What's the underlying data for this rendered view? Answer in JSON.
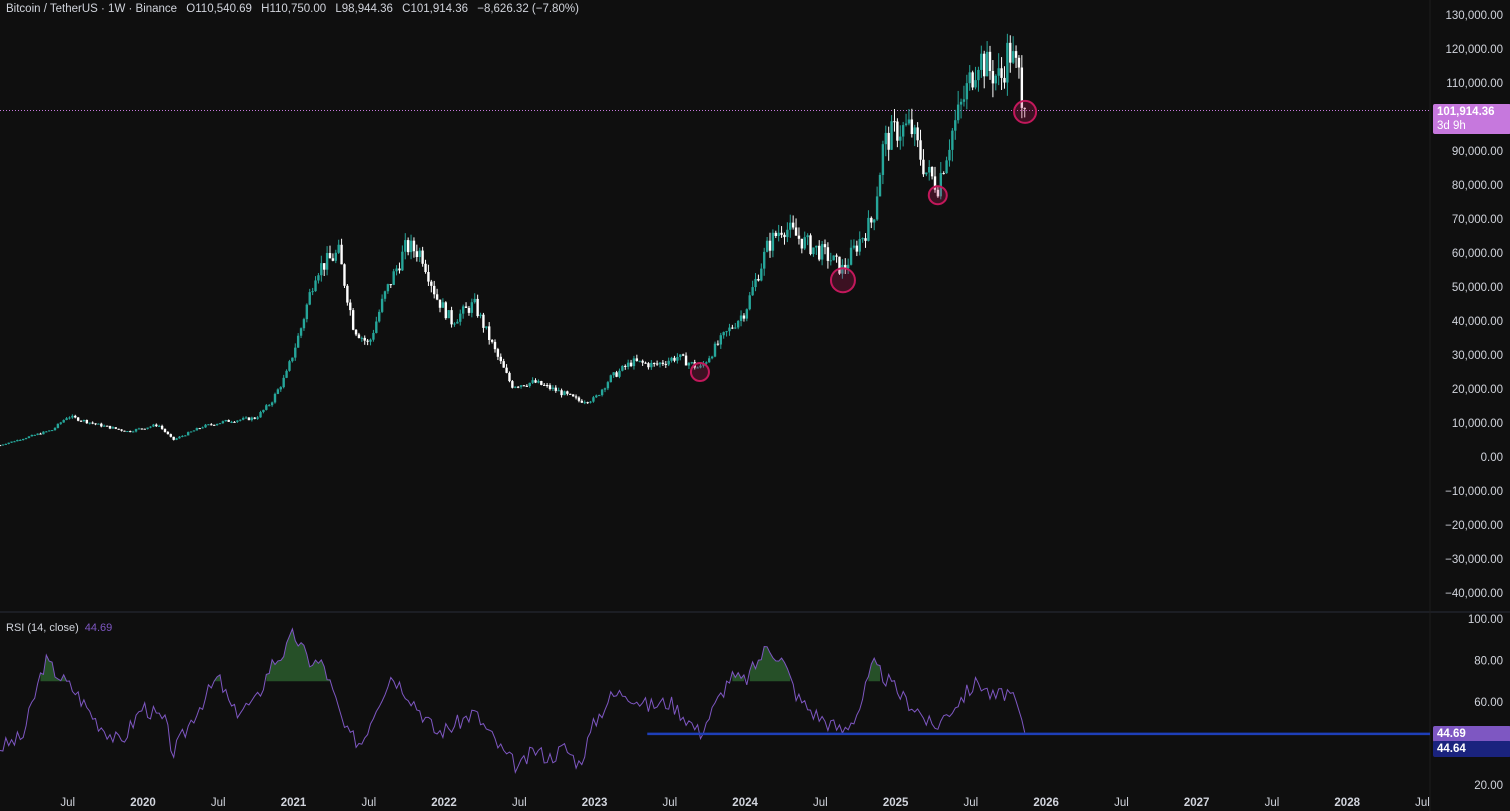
{
  "header": {
    "symbol": "Bitcoin / TetherUS · 1W · Binance",
    "o_label": "O",
    "o_value": "110,540.69",
    "h_label": "H",
    "h_value": "110,750.00",
    "l_label": "L",
    "l_value": "98,944.36",
    "c_label": "C",
    "c_value": "101,914.36",
    "change": "−8,626.32 (−7.80%)"
  },
  "price_badge": {
    "price": "101,914.36",
    "countdown": "3d 9h"
  },
  "rsi_legend": {
    "label": "RSI (14, close)",
    "value": "44.69"
  },
  "rsi_badges": {
    "rsi": "44.69",
    "line": "44.64"
  },
  "colors": {
    "up": "#26a69a",
    "down": "#ffffff",
    "rsi_line": "#7e57c2",
    "support_line": "#1e3fb8",
    "highlight": "#c2185b",
    "price_line": "#c678dd"
  },
  "chart_data": [
    {
      "type": "candlestick",
      "ylim": [
        -45000,
        130000
      ],
      "y_ticks": [
        "130,000.00",
        "120,000.00",
        "110,000.00",
        "100,000.00",
        "90,000.00",
        "80,000.00",
        "70,000.00",
        "60,000.00",
        "50,000.00",
        "40,000.00",
        "30,000.00",
        "20,000.00",
        "10,000.00",
        "0.00",
        "−10,000.00",
        "−20,000.00",
        "−30,000.00",
        "−40,000.00"
      ],
      "y_tick_values": [
        130000,
        120000,
        110000,
        100000,
        90000,
        80000,
        70000,
        60000,
        50000,
        40000,
        30000,
        20000,
        10000,
        0,
        -10000,
        -20000,
        -30000,
        -40000
      ],
      "x_ticks": [
        "Jul",
        "2020",
        "Jul",
        "2021",
        "Jul",
        "2022",
        "Jul",
        "2023",
        "Jul",
        "2024",
        "Jul",
        "2025",
        "Jul",
        "2026",
        "Jul",
        "2027",
        "Jul",
        "2028",
        "Jul"
      ],
      "x_tick_dates": [
        2019.5,
        2020.0,
        2020.5,
        2021.0,
        2021.5,
        2022.0,
        2022.5,
        2023.0,
        2023.5,
        2024.0,
        2024.5,
        2025.0,
        2025.5,
        2026.0,
        2026.5,
        2027.0,
        2027.5,
        2028.0,
        2028.5
      ],
      "xlim": [
        2019.05,
        2028.55
      ],
      "price_line": 101914.36,
      "key_points": [
        [
          2019.05,
          3500
        ],
        [
          2019.4,
          8000
        ],
        [
          2019.5,
          12000
        ],
        [
          2019.7,
          9500
        ],
        [
          2019.9,
          7500
        ],
        [
          2020.1,
          9500
        ],
        [
          2020.2,
          5000
        ],
        [
          2020.4,
          9000
        ],
        [
          2020.55,
          10500
        ],
        [
          2020.75,
          11500
        ],
        [
          2020.85,
          16000
        ],
        [
          2020.95,
          24000
        ],
        [
          2021.05,
          38000
        ],
        [
          2021.15,
          55000
        ],
        [
          2021.3,
          60000
        ],
        [
          2021.4,
          38000
        ],
        [
          2021.5,
          33000
        ],
        [
          2021.6,
          47000
        ],
        [
          2021.75,
          62000
        ],
        [
          2021.85,
          60000
        ],
        [
          2021.95,
          47000
        ],
        [
          2022.05,
          40000
        ],
        [
          2022.2,
          45000
        ],
        [
          2022.35,
          30000
        ],
        [
          2022.45,
          21000
        ],
        [
          2022.6,
          22000
        ],
        [
          2022.75,
          19500
        ],
        [
          2022.9,
          16500
        ],
        [
          2023.0,
          17000
        ],
        [
          2023.1,
          23000
        ],
        [
          2023.25,
          28000
        ],
        [
          2023.4,
          27000
        ],
        [
          2023.55,
          29500
        ],
        [
          2023.7,
          26000
        ],
        [
          2023.85,
          35000
        ],
        [
          2024.0,
          43000
        ],
        [
          2024.15,
          62000
        ],
        [
          2024.25,
          68000
        ],
        [
          2024.4,
          63000
        ],
        [
          2024.55,
          59000
        ],
        [
          2024.65,
          55000
        ],
        [
          2024.75,
          63000
        ],
        [
          2024.85,
          70000
        ],
        [
          2024.92,
          92000
        ],
        [
          2025.0,
          96000
        ],
        [
          2025.1,
          97000
        ],
        [
          2025.2,
          84000
        ],
        [
          2025.28,
          80000
        ],
        [
          2025.37,
          95000
        ],
        [
          2025.45,
          105000
        ],
        [
          2025.55,
          118000
        ],
        [
          2025.62,
          114000
        ],
        [
          2025.7,
          111000
        ],
        [
          2025.75,
          120000
        ],
        [
          2025.82,
          112000
        ],
        [
          2025.86,
          101914
        ]
      ],
      "highlights": [
        {
          "date": 2023.7,
          "value": 25000
        },
        {
          "date": 2024.65,
          "value": 52000
        },
        {
          "date": 2025.28,
          "value": 77000
        },
        {
          "date": 2025.86,
          "value": 101500
        }
      ]
    },
    {
      "type": "line",
      "name": "RSI (14, close)",
      "ylim": [
        18,
        102
      ],
      "y_ticks": [
        "100.00",
        "80.00",
        "60.00",
        "40.00",
        "20.00"
      ],
      "y_tick_values": [
        100,
        80,
        60,
        40,
        20
      ],
      "key_points": [
        [
          2019.05,
          38
        ],
        [
          2019.2,
          43
        ],
        [
          2019.35,
          80
        ],
        [
          2019.45,
          72
        ],
        [
          2019.55,
          65
        ],
        [
          2019.7,
          50
        ],
        [
          2019.85,
          40
        ],
        [
          2020.0,
          58
        ],
        [
          2020.15,
          50
        ],
        [
          2020.2,
          35
        ],
        [
          2020.35,
          55
        ],
        [
          2020.5,
          72
        ],
        [
          2020.6,
          55
        ],
        [
          2020.75,
          60
        ],
        [
          2020.85,
          78
        ],
        [
          2020.95,
          85
        ],
        [
          2021.0,
          93
        ],
        [
          2021.1,
          80
        ],
        [
          2021.2,
          78
        ],
        [
          2021.35,
          45
        ],
        [
          2021.45,
          40
        ],
        [
          2021.55,
          58
        ],
        [
          2021.65,
          73
        ],
        [
          2021.75,
          65
        ],
        [
          2021.85,
          55
        ],
        [
          2021.95,
          45
        ],
        [
          2022.05,
          48
        ],
        [
          2022.2,
          55
        ],
        [
          2022.3,
          45
        ],
        [
          2022.4,
          35
        ],
        [
          2022.5,
          28
        ],
        [
          2022.6,
          37
        ],
        [
          2022.7,
          33
        ],
        [
          2022.8,
          38
        ],
        [
          2022.9,
          30
        ],
        [
          2023.0,
          50
        ],
        [
          2023.1,
          62
        ],
        [
          2023.2,
          65
        ],
        [
          2023.35,
          58
        ],
        [
          2023.5,
          60
        ],
        [
          2023.6,
          53
        ],
        [
          2023.7,
          45
        ],
        [
          2023.8,
          58
        ],
        [
          2023.9,
          72
        ],
        [
          2024.0,
          70
        ],
        [
          2024.15,
          87
        ],
        [
          2024.25,
          80
        ],
        [
          2024.35,
          62
        ],
        [
          2024.45,
          55
        ],
        [
          2024.55,
          50
        ],
        [
          2024.65,
          46
        ],
        [
          2024.75,
          55
        ],
        [
          2024.85,
          78
        ],
        [
          2024.95,
          70
        ],
        [
          2025.05,
          62
        ],
        [
          2025.15,
          56
        ],
        [
          2025.25,
          47
        ],
        [
          2025.35,
          55
        ],
        [
          2025.45,
          63
        ],
        [
          2025.55,
          70
        ],
        [
          2025.65,
          62
        ],
        [
          2025.75,
          65
        ],
        [
          2025.82,
          55
        ],
        [
          2025.86,
          44.69
        ]
      ],
      "support_line": {
        "value": 44.64,
        "from": 2023.35
      }
    }
  ]
}
